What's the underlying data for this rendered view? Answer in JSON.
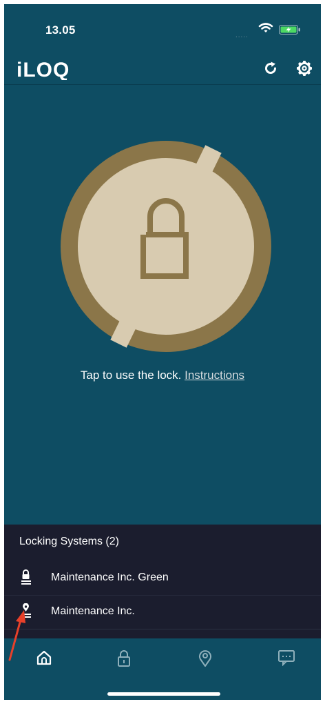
{
  "status_bar": {
    "time": "13.05",
    "signal": "....."
  },
  "header": {
    "logo_text": "iLOQ",
    "refresh_icon": "refresh-icon",
    "settings_icon": "gear-icon"
  },
  "lock": {
    "icon": "padlock-icon",
    "hint_text": "Tap to use the lock. ",
    "instructions_link": "Instructions"
  },
  "locking_systems": {
    "title": "Locking Systems (2)",
    "items": [
      {
        "label": "Maintenance Inc. Green",
        "icon": "key-list-icon"
      },
      {
        "label": "Maintenance Inc.",
        "icon": "location-key-list-icon"
      }
    ]
  },
  "tab_bar": {
    "tabs": [
      {
        "name": "home",
        "icon": "home-icon"
      },
      {
        "name": "locks",
        "icon": "padlock-icon"
      },
      {
        "name": "keys",
        "icon": "key-tag-icon"
      },
      {
        "name": "messages",
        "icon": "message-icon"
      }
    ]
  },
  "colors": {
    "background": "#0e4d63",
    "lock_ring": "#8b7649",
    "lock_face": "#d8cbb0",
    "panel": "#1b1d2e",
    "annotation": "#e8402a"
  }
}
